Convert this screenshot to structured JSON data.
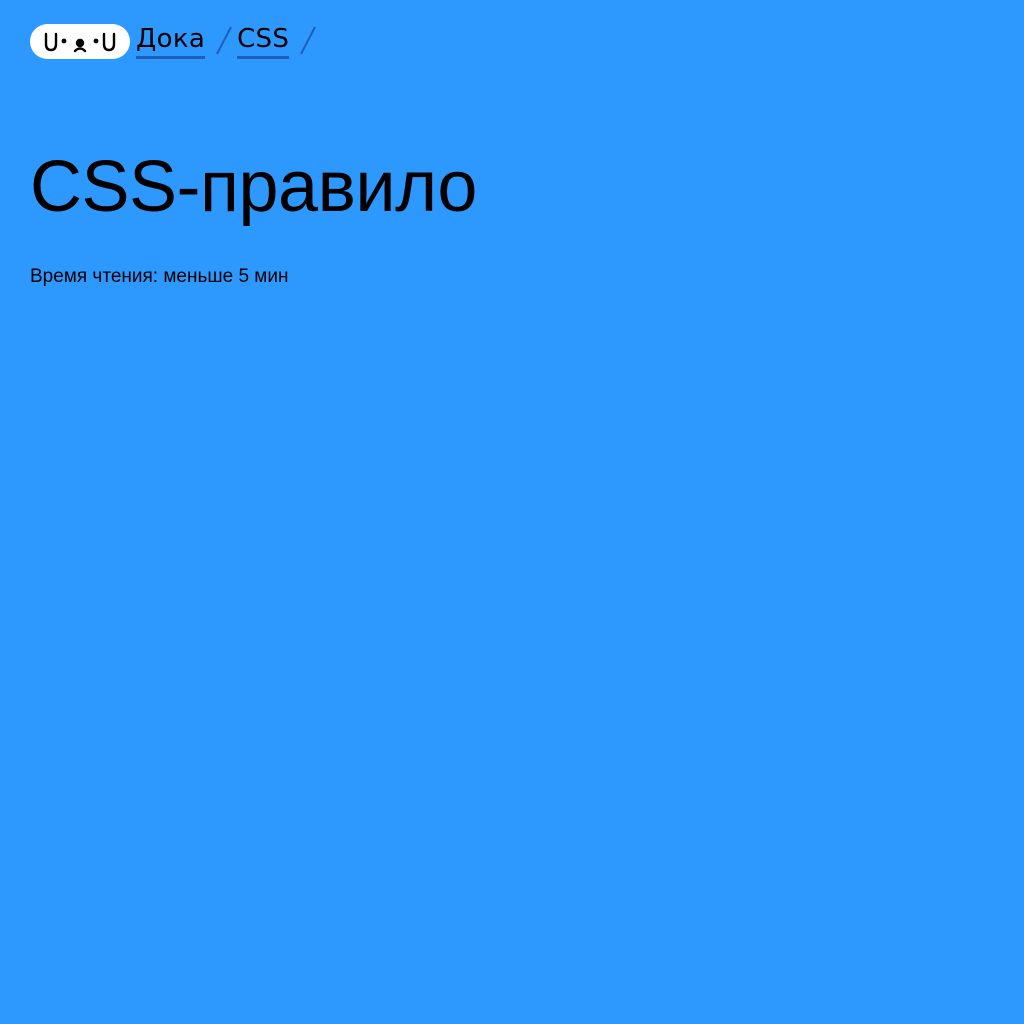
{
  "logo": {
    "text": "U•ᴥ•U",
    "icon": "doka-dog-logo-icon"
  },
  "breadcrumb": {
    "items": [
      {
        "label": "Дока"
      },
      {
        "label": "CSS"
      }
    ],
    "separator_icon": "slash-separator-icon"
  },
  "page": {
    "title": "CSS-правило",
    "reading_time": "Время чтения: меньше 5 мин"
  },
  "colors": {
    "background": "#2d99ff",
    "text": "#000000",
    "link_underline": "#1f5fb8",
    "logo_background": "#ffffff"
  }
}
